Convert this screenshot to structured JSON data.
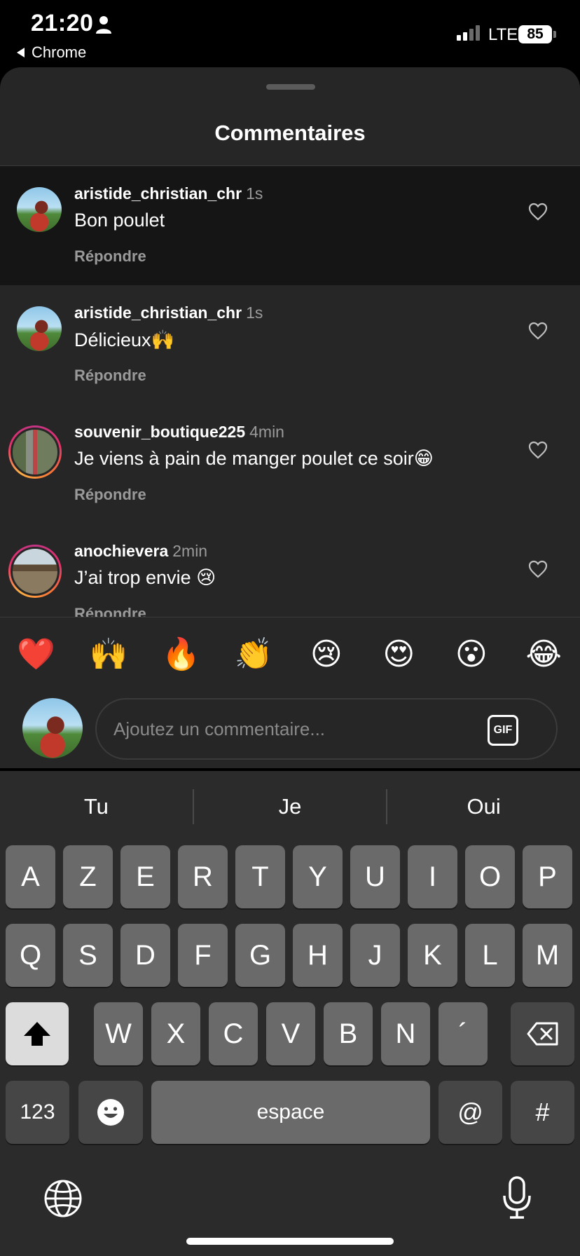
{
  "status_bar": {
    "time": "21:20",
    "back_app": "Chrome",
    "network": "LTE",
    "battery": "85"
  },
  "sheet": {
    "title": "Commentaires"
  },
  "comments": [
    {
      "user": "aristide_christian_chr",
      "time": "1s",
      "text": "Bon poulet",
      "reply": "Répondre"
    },
    {
      "user": "aristide_christian_chr",
      "time": "1s",
      "text": "Délicieux🙌",
      "reply": "Répondre"
    },
    {
      "user": "souvenir_boutique225",
      "time": "4min",
      "text": "Je viens à pain de manger poulet ce soir😁",
      "reply": "Répondre"
    },
    {
      "user": "anochievera",
      "time": "2min",
      "text": "J’ai trop envie 😢",
      "reply": "Répondre"
    }
  ],
  "quick_emojis": [
    "❤️",
    "🙌",
    "🔥",
    "👏",
    "😢",
    "😍",
    "😮",
    "😂"
  ],
  "composer": {
    "placeholder": "Ajoutez un commentaire...",
    "gif_label": "GIF"
  },
  "keyboard": {
    "suggestions": [
      "Tu",
      "Je",
      "Oui"
    ],
    "row1": [
      "A",
      "Z",
      "E",
      "R",
      "T",
      "Y",
      "U",
      "I",
      "O",
      "P"
    ],
    "row2": [
      "Q",
      "S",
      "D",
      "F",
      "G",
      "H",
      "J",
      "K",
      "L",
      "M"
    ],
    "row3": [
      "W",
      "X",
      "C",
      "V",
      "B",
      "N",
      "´"
    ],
    "numbers_label": "123",
    "space_label": "espace",
    "at_label": "@",
    "hash_label": "#"
  }
}
